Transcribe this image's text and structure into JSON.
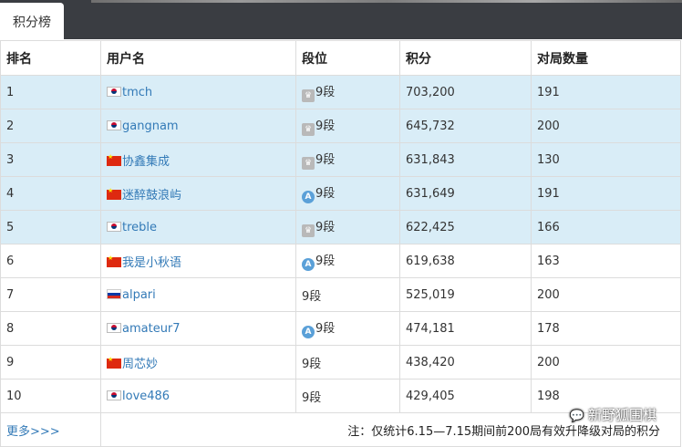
{
  "tab": {
    "label": "积分榜"
  },
  "headers": [
    "排名",
    "用户名",
    "段位",
    "积分",
    "对局数量"
  ],
  "rows": [
    {
      "rank": "1",
      "flag": "kr",
      "user": "tmch",
      "rank_icon": "crown-icon",
      "dan": "9段",
      "score": "703,200",
      "games": "191",
      "highlight": true
    },
    {
      "rank": "2",
      "flag": "kr",
      "user": "gangnam",
      "rank_icon": "crown-icon",
      "dan": "9段",
      "score": "645,732",
      "games": "200",
      "highlight": true
    },
    {
      "rank": "3",
      "flag": "cn",
      "user": "协鑫集成",
      "rank_icon": "crown-icon",
      "dan": "9段",
      "score": "631,843",
      "games": "130",
      "highlight": true
    },
    {
      "rank": "4",
      "flag": "cn",
      "user": "迷醉鼓浪屿",
      "rank_icon": "a-badge-icon",
      "dan": "9段",
      "score": "631,649",
      "games": "191",
      "highlight": true
    },
    {
      "rank": "5",
      "flag": "kr",
      "user": "treble",
      "rank_icon": "crown-icon",
      "dan": "9段",
      "score": "622,425",
      "games": "166",
      "highlight": true
    },
    {
      "rank": "6",
      "flag": "cn",
      "user": "我是小秋语",
      "rank_icon": "a-badge-icon",
      "dan": "9段",
      "score": "619,638",
      "games": "163",
      "highlight": false
    },
    {
      "rank": "7",
      "flag": "ru",
      "user": "alpari",
      "rank_icon": "",
      "dan": "9段",
      "score": "525,019",
      "games": "200",
      "highlight": false
    },
    {
      "rank": "8",
      "flag": "kr",
      "user": "amateur7",
      "rank_icon": "a-badge-icon",
      "dan": "9段",
      "score": "474,181",
      "games": "178",
      "highlight": false
    },
    {
      "rank": "9",
      "flag": "cn",
      "user": "周芯妙",
      "rank_icon": "",
      "dan": "9段",
      "score": "438,420",
      "games": "200",
      "highlight": false
    },
    {
      "rank": "10",
      "flag": "kr",
      "user": "love486",
      "rank_icon": "",
      "dan": "9段",
      "score": "429,405",
      "games": "198",
      "highlight": false
    }
  ],
  "footer": {
    "more_link": "更多>>>",
    "note": "注：仅统计6.15—7.15期间前200局有效升降级对局的积分"
  },
  "watermark": "新野狐围棋",
  "colors": {
    "highlight_row": "#d9edf7",
    "link": "#337ab7",
    "topbar": "#3a3d42"
  }
}
